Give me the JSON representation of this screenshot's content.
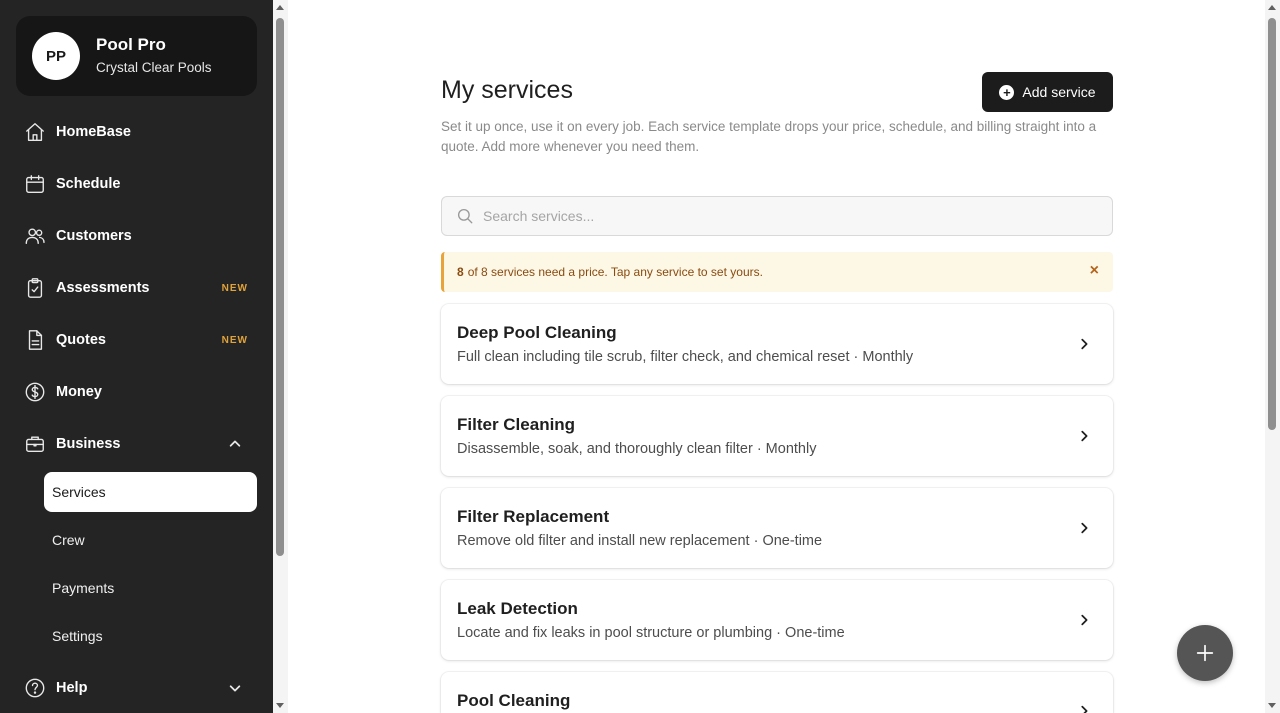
{
  "profile": {
    "initials": "PP",
    "name": "Pool Pro",
    "company": "Crystal Clear Pools"
  },
  "nav": {
    "items": [
      {
        "label": "HomeBase",
        "icon": "home-icon"
      },
      {
        "label": "Schedule",
        "icon": "calendar-icon"
      },
      {
        "label": "Customers",
        "icon": "users-icon"
      },
      {
        "label": "Assessments",
        "icon": "clipboard-check-icon",
        "badge": "NEW"
      },
      {
        "label": "Quotes",
        "icon": "document-icon",
        "badge": "NEW"
      },
      {
        "label": "Money",
        "icon": "dollar-circle-icon"
      },
      {
        "label": "Business",
        "icon": "briefcase-icon"
      },
      {
        "label": "Help",
        "icon": "help-circle-icon"
      }
    ],
    "business_sub": [
      "Services",
      "Crew",
      "Payments",
      "Settings"
    ]
  },
  "main": {
    "title": "My services",
    "description": "Set it up once, use it on every job. Each service template drops your price, schedule, and billing straight into a quote. Add more whenever you need them.",
    "add_button": "Add service",
    "search_placeholder": "Search services...",
    "alert": {
      "count": "8",
      "rest": "of 8 services need a price. Tap any service to set yours.",
      "close": "×"
    }
  },
  "services": [
    {
      "name": "Deep Pool Cleaning",
      "desc": "Full clean including tile scrub, filter check, and chemical reset · Monthly"
    },
    {
      "name": "Filter Cleaning",
      "desc": "Disassemble, soak, and thoroughly clean filter · Monthly"
    },
    {
      "name": "Filter Replacement",
      "desc": "Remove old filter and install new replacement · One-time"
    },
    {
      "name": "Leak Detection",
      "desc": "Locate and fix leaks in pool structure or plumbing · One-time"
    },
    {
      "name": "Pool Cleaning",
      "desc": ""
    }
  ],
  "colors": {
    "sidebar": "#242424",
    "accent_badge": "#e0a33a",
    "alert_bg": "#fdf7e6",
    "alert_border": "#e8a33b"
  }
}
